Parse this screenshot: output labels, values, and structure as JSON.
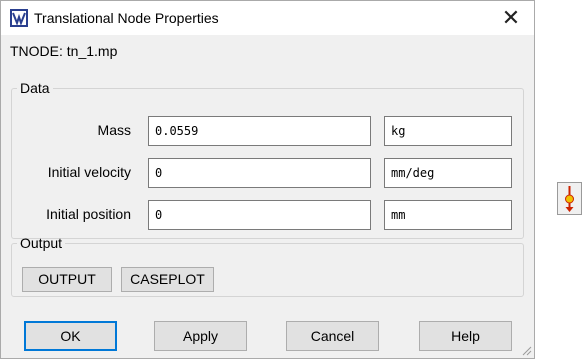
{
  "window": {
    "title": "Translational Node Properties",
    "icon": "app-icon",
    "close_icon": "close-icon"
  },
  "node_label": "TNODE: tn_1.mp",
  "data_group": {
    "title": "Data",
    "rows": [
      {
        "label": "Mass",
        "value": "0.0559",
        "unit": "kg"
      },
      {
        "label": "Initial velocity",
        "value": "0",
        "unit": "mm/deg"
      },
      {
        "label": "Initial position",
        "value": "0",
        "unit": "mm"
      }
    ]
  },
  "output_group": {
    "title": "Output",
    "buttons": [
      "OUTPUT",
      "CASEPLOT"
    ]
  },
  "footer": {
    "ok": "OK",
    "apply": "Apply",
    "cancel": "Cancel",
    "help": "Help"
  },
  "side_widget": {
    "icon": "translational-node-icon"
  },
  "colors": {
    "default_button_border": "#0078d7",
    "dialog_bg": "#f0f0f0",
    "node_icon_red": "#cc2200",
    "node_icon_yellow": "#f0c000"
  }
}
